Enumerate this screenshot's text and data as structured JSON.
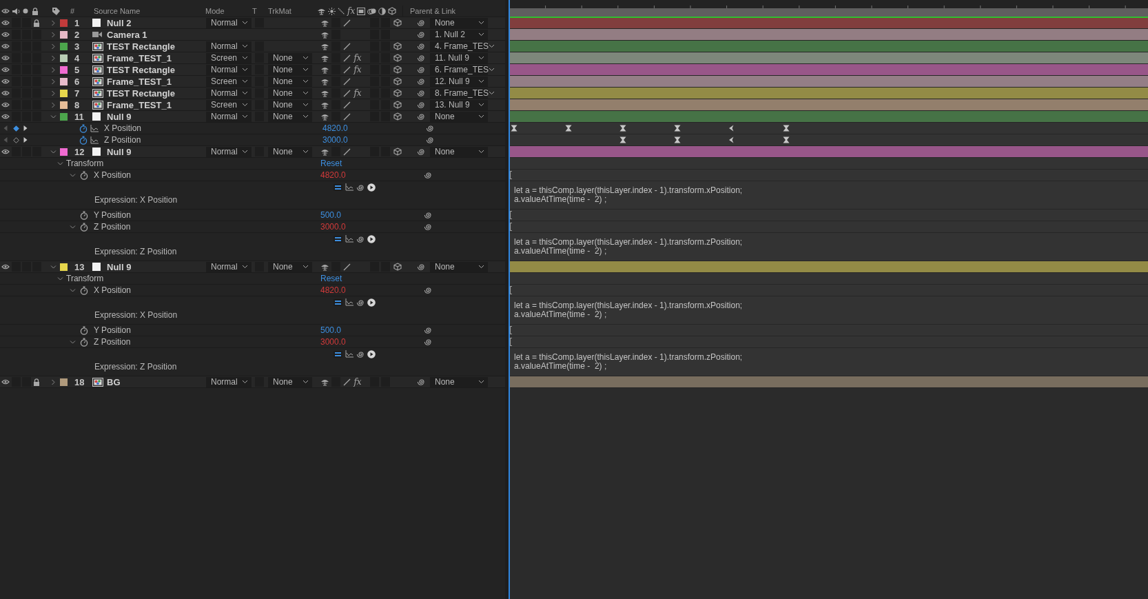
{
  "header": {
    "number": "#",
    "source_name": "Source Name",
    "mode": "Mode",
    "t": "T",
    "trkmat": "TrkMat",
    "fx": "fx",
    "parent": "Parent & Link"
  },
  "layers": [
    {
      "number": "1",
      "name": "Null 2",
      "kind": "solid",
      "color": "#c23b3b",
      "visible": true,
      "locked": true,
      "expanded": false,
      "mode": "Normal",
      "quality": true,
      "three_d": true,
      "parent": "None"
    },
    {
      "number": "2",
      "name": "Camera 1",
      "kind": "camera",
      "color": "#e6b9c6",
      "visible": true,
      "locked": false,
      "expanded": false,
      "parent": "1. Null 2"
    },
    {
      "number": "3",
      "name": "TEST Rectangle",
      "kind": "footage",
      "color": "#4ca64c",
      "visible": true,
      "locked": false,
      "expanded": false,
      "mode": "Normal",
      "quality": true,
      "three_d": true,
      "parent": "4. Frame_TES"
    },
    {
      "number": "4",
      "name": "Frame_TEST_1",
      "kind": "footage",
      "color": "#b9cdb5",
      "visible": true,
      "locked": false,
      "expanded": false,
      "mode": "Screen",
      "trkmat": "None",
      "quality": true,
      "fx": "fx",
      "three_d": true,
      "parent": "11. Null 9"
    },
    {
      "number": "5",
      "name": "TEST Rectangle",
      "kind": "footage",
      "color": "#f06bd1",
      "visible": true,
      "locked": false,
      "expanded": false,
      "mode": "Normal",
      "trkmat": "None",
      "quality": true,
      "fx": "fx",
      "three_d": true,
      "parent": "6. Frame_TES"
    },
    {
      "number": "6",
      "name": "Frame_TEST_1",
      "kind": "footage",
      "color": "#e8bccb",
      "visible": true,
      "locked": false,
      "expanded": false,
      "mode": "Screen",
      "trkmat": "None",
      "quality": true,
      "three_d": true,
      "parent": "12. Null 9"
    },
    {
      "number": "7",
      "name": "TEST Rectangle",
      "kind": "footage",
      "color": "#e6d64c",
      "visible": true,
      "locked": false,
      "expanded": false,
      "mode": "Normal",
      "trkmat": "None",
      "quality": true,
      "fx": "fx",
      "three_d": true,
      "parent": "8. Frame_TES"
    },
    {
      "number": "8",
      "name": "Frame_TEST_1",
      "kind": "footage",
      "color": "#e6bd98",
      "visible": true,
      "locked": false,
      "expanded": false,
      "mode": "Screen",
      "trkmat": "None",
      "quality": true,
      "three_d": true,
      "parent": "13. Null 9"
    },
    {
      "number": "11",
      "name": "Null 9",
      "kind": "solid",
      "color": "#4ca64c",
      "visible": true,
      "locked": false,
      "expanded": true,
      "mode": "Normal",
      "trkmat": "None",
      "quality": true,
      "three_d": true,
      "parent": "None",
      "children": [
        {
          "kind": "animated",
          "name": "X Position",
          "value": "4820.0",
          "at_keyframe": true,
          "keyframes": [
            {
              "kind": "hourglass"
            },
            {
              "kind": "hourglass"
            },
            {
              "kind": "hourglass"
            },
            {
              "kind": "hourglass"
            },
            {
              "kind": "arrow"
            },
            {
              "kind": "hourglass"
            }
          ]
        },
        {
          "kind": "animated",
          "name": "Z Position",
          "value": "3000.0",
          "at_keyframe": false,
          "keyframes": [
            {
              "kind": "empty"
            },
            {
              "kind": "empty"
            },
            {
              "kind": "hourglass"
            },
            {
              "kind": "hourglass"
            },
            {
              "kind": "arrow"
            },
            {
              "kind": "hourglass"
            }
          ]
        }
      ]
    },
    {
      "number": "12",
      "name": "Null 9",
      "kind": "solid",
      "color": "#f06bd1",
      "visible": true,
      "locked": false,
      "expanded": true,
      "mode": "Normal",
      "trkmat": "None",
      "quality": true,
      "three_d": true,
      "parent": "None",
      "children": [
        {
          "kind": "group",
          "name": "Transform",
          "link": "Reset",
          "expanded": true,
          "children": [
            {
              "kind": "property",
              "name": "X Position",
              "value": "4820.0",
              "expression": {
                "label": "Expression: X Position",
                "code": [
                  "let a = thisComp.layer(thisLayer.index - 1).transform.xPosition;",
                  "a.valueAtTime(time -  2) ;"
                ]
              }
            },
            {
              "kind": "property",
              "name": "Y Position",
              "value": "500.0"
            },
            {
              "kind": "property",
              "name": "Z Position",
              "value": "3000.0",
              "expression": {
                "label": "Expression: Z Position",
                "code": [
                  "let a = thisComp.layer(thisLayer.index - 1).transform.zPosition;",
                  "a.valueAtTime(time -  2) ;"
                ]
              }
            }
          ]
        }
      ]
    },
    {
      "number": "13",
      "name": "Null 9",
      "kind": "solid",
      "color": "#e6d64c",
      "visible": true,
      "locked": false,
      "expanded": true,
      "mode": "Normal",
      "trkmat": "None",
      "quality": true,
      "three_d": true,
      "parent": "None",
      "children": [
        {
          "kind": "group",
          "name": "Transform",
          "link": "Reset",
          "expanded": true,
          "children": [
            {
              "kind": "property",
              "name": "X Position",
              "value": "4820.0",
              "expression": {
                "label": "Expression: X Position",
                "code": [
                  "let a = thisComp.layer(thisLayer.index - 1).transform.xPosition;",
                  "a.valueAtTime(time -  2) ;"
                ]
              }
            },
            {
              "kind": "property",
              "name": "Y Position",
              "value": "500.0"
            },
            {
              "kind": "property",
              "name": "Z Position",
              "value": "3000.0",
              "expression": {
                "label": "Expression: Z Position",
                "code": [
                  "let a = thisComp.layer(thisLayer.index - 1).transform.zPosition;",
                  "a.valueAtTime(time -  2) ;"
                ]
              }
            }
          ]
        }
      ]
    },
    {
      "number": "18",
      "name": "BG",
      "kind": "footage",
      "color": "#b09a7c",
      "visible": true,
      "locked": true,
      "expanded": false,
      "mode": "Normal",
      "trkmat": "None",
      "quality": true,
      "fx": "fx",
      "parent": "None"
    }
  ]
}
